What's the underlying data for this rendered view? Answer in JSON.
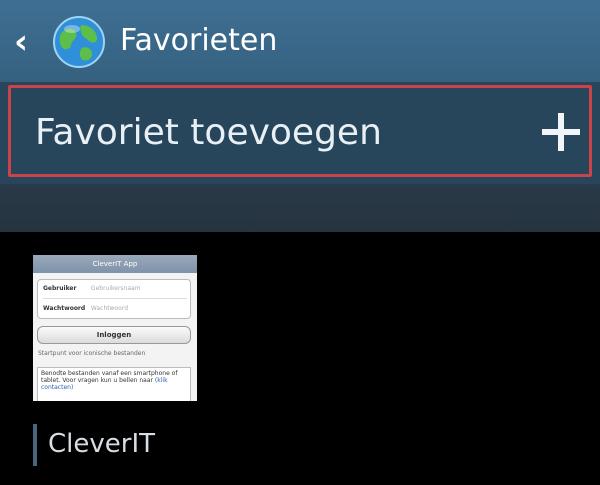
{
  "topbar": {
    "title": "Favorieten",
    "back_icon": "chevron-left-icon",
    "app_icon": "globe-icon"
  },
  "add_row": {
    "label": "Favoriet toevoegen",
    "icon": "plus-icon"
  },
  "bookmark": {
    "name": "CleverIT",
    "thumbnail": {
      "header": "CleverIT App",
      "field1_label": "Gebruiker",
      "field1_placeholder": "Gebruikersnaam",
      "field2_label": "Wachtwoord",
      "field2_placeholder": "Wachtwoord",
      "button": "Inloggen",
      "info": "Startpunt voor iconische bestanden",
      "description": "Benodte bestanden vanaf een smartphone of tablet. Voor vragen kun u bellen naar",
      "description_link": "(klik contacten)"
    }
  },
  "colors": {
    "topbar": "#3a6889",
    "add_row_bg": "#27465c",
    "highlight_border": "#c8434a",
    "background": "#000000"
  }
}
